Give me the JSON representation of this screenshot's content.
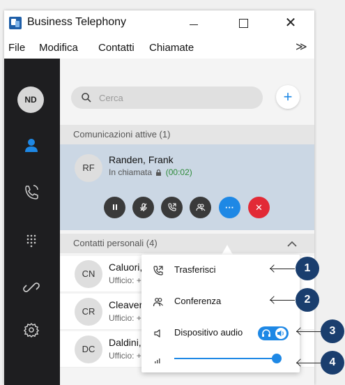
{
  "window": {
    "title": "Business Telephony",
    "controls": {
      "minimize": "—",
      "maximize": "☐",
      "close": "✕"
    }
  },
  "menu": {
    "items": [
      "File",
      "Modifica",
      "Contatti",
      "Chiamate"
    ],
    "overflow": "≫"
  },
  "sidebar": {
    "user_initials": "ND",
    "items": [
      {
        "icon": "contacts-icon",
        "active": true
      },
      {
        "icon": "call-history-icon",
        "active": false
      },
      {
        "icon": "dialpad-icon",
        "active": false
      },
      {
        "icon": "link-icon",
        "active": false
      },
      {
        "icon": "gear-icon",
        "active": false
      }
    ],
    "active_color": "#1e88e5"
  },
  "search": {
    "placeholder": "Cerca",
    "value": ""
  },
  "add_button": "+",
  "active_section": {
    "header": "Comunicazioni attive (1)",
    "call": {
      "initials": "RF",
      "name": "Randen, Frank",
      "status": "In chiamata",
      "timer": "(00:02)"
    },
    "controls": [
      "pause-icon",
      "mute-icon",
      "transfer-icon",
      "conference-icon",
      "more-icon",
      "end-call-icon"
    ],
    "more_label": "···",
    "end_label": "✕"
  },
  "contacts_section": {
    "header": "Contatti personali (4)",
    "rows": [
      {
        "initials": "CN",
        "name": "Caluori, N",
        "sub": "Ufficio: +"
      },
      {
        "initials": "CR",
        "name": "Cleaver, R",
        "sub": "Ufficio: +"
      },
      {
        "initials": "DC",
        "name": "Daldini, C",
        "sub": "Ufficio: +"
      }
    ]
  },
  "popup": {
    "transfer": "Trasferisci",
    "conference": "Conferenza",
    "audio_device": "Dispositivo audio",
    "volume_level": 0.97
  },
  "annotations": [
    "1",
    "2",
    "3",
    "4"
  ],
  "colors": {
    "accent": "#1e88e5",
    "end_call": "#e22a36",
    "sidebar": "#1e1e20",
    "annotation": "#1a3e6e",
    "timer": "#2e8b3a"
  }
}
